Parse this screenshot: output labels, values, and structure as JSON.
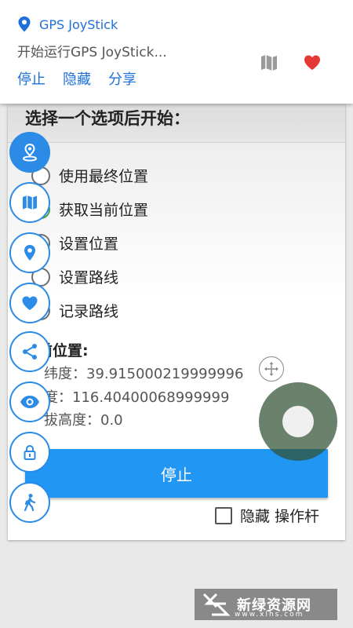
{
  "notification": {
    "app_name": "GPS JoyStick",
    "text": "开始运行GPS JoyStick...",
    "actions": [
      {
        "label": "停止"
      },
      {
        "label": "隐藏"
      },
      {
        "label": "分享"
      }
    ],
    "accent_color": "#1e6fd9",
    "heart_color": "#e53935"
  },
  "dialog": {
    "title": "选择一个选项后开始：",
    "options": [
      {
        "label": "使用最终位置",
        "checked": false
      },
      {
        "label": "获取当前位置",
        "checked": true
      },
      {
        "label": "设置位置",
        "checked": false
      },
      {
        "label": "设置路线",
        "checked": false
      },
      {
        "label": "记录路线",
        "checked": false
      }
    ],
    "current_position": {
      "title": "前位置:",
      "latitude": "纬度：39.915000219999996",
      "longitude": "度：116.40400068999999",
      "altitude": "拔高度：0.0"
    },
    "stop_button": "停止",
    "hide_joystick_label": "隐藏 操作杆",
    "hide_joystick_checked": false,
    "button_color": "#2196f3"
  },
  "sidebar": {
    "buttons": [
      {
        "icon": "location-person-icon"
      },
      {
        "icon": "map-icon"
      },
      {
        "icon": "location-pin-icon"
      },
      {
        "icon": "heart-icon"
      },
      {
        "icon": "share-icon"
      },
      {
        "icon": "eye-icon"
      },
      {
        "icon": "lock-icon"
      },
      {
        "icon": "walk-icon"
      }
    ],
    "accent_color": "#2b8be6"
  },
  "watermark": {
    "text": "新绿资源网",
    "subtext": "www.xlhs.com"
  }
}
